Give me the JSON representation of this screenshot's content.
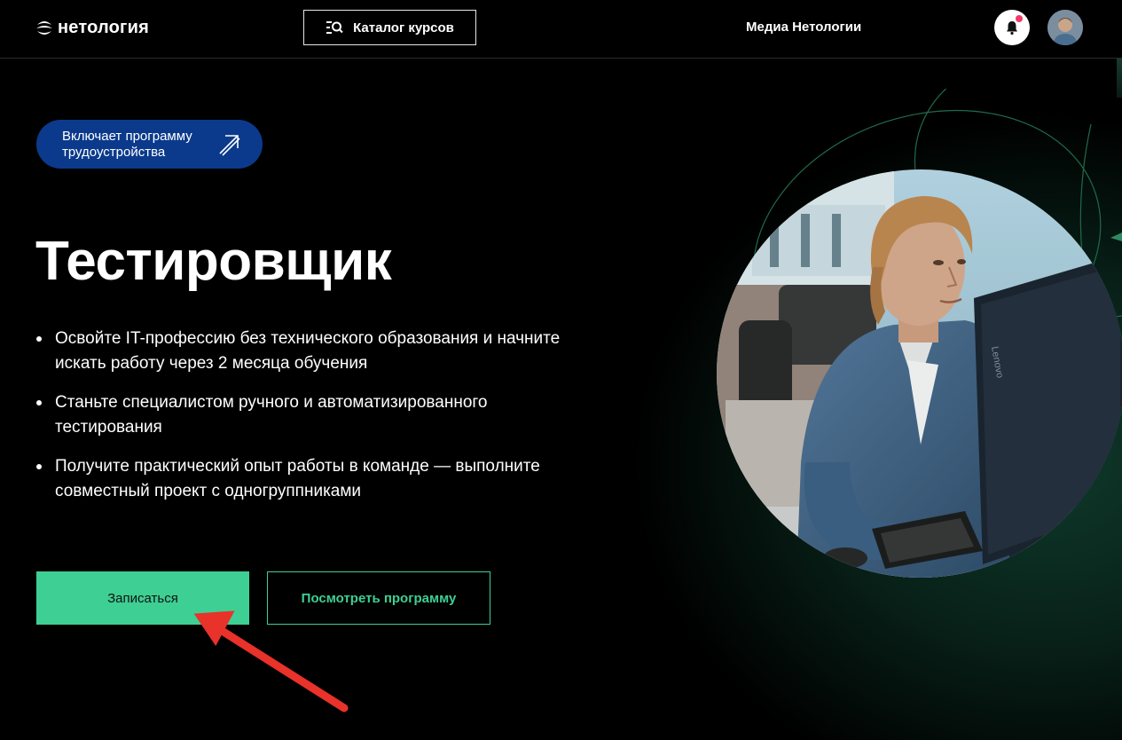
{
  "header": {
    "logo_text": "нетология",
    "catalog_label": "Каталог курсов",
    "media_label": "Медиа Нетологии"
  },
  "hero": {
    "badge_text": "Включает программу трудоустройства",
    "title": "Тестировщик",
    "bullets": [
      "Освойте IT-профессию без технического образования и начните искать работу через 2 месяца обучения",
      "Станьте специалистом ручного и автоматизированного тестирования",
      "Получите практический опыт работы в команде — выполните совместный проект с одногруппниками"
    ],
    "enroll_label": "Записаться",
    "program_label": "Посмотреть программу"
  },
  "colors": {
    "accent_green": "#3ecf94",
    "badge_blue": "#0b3a8c",
    "notification_dot": "#f13a6a",
    "background": "#000000"
  },
  "icons": [
    "logo-icon",
    "catalog-search-icon",
    "bell-icon",
    "arrow-up-right-icon",
    "annotation-arrow"
  ]
}
